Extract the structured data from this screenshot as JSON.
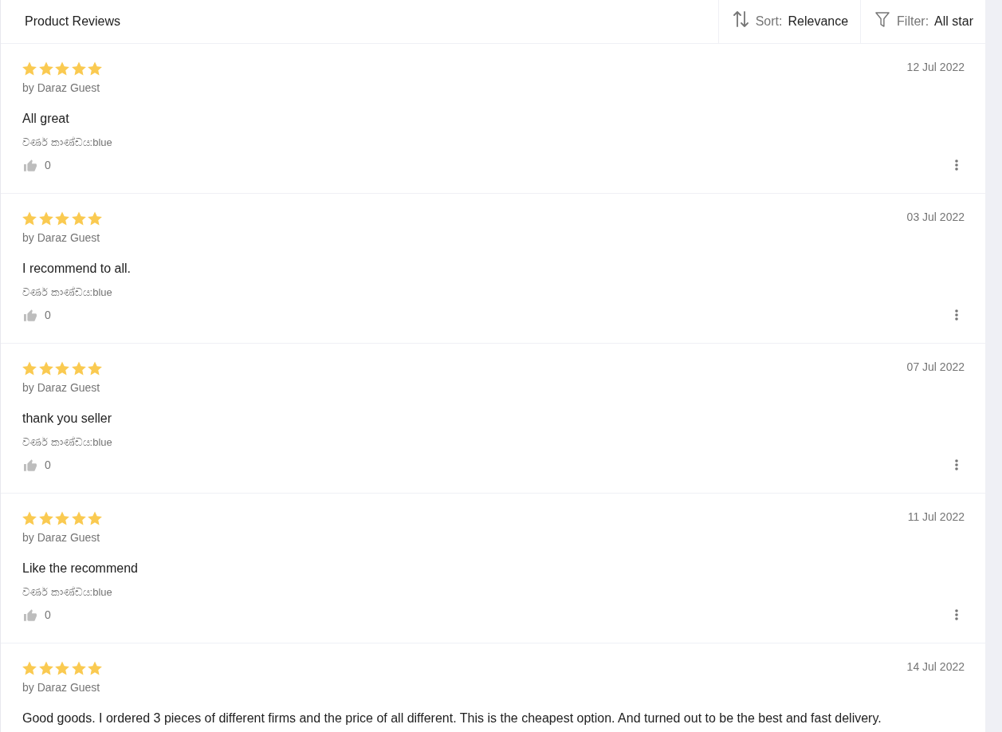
{
  "header": {
    "title": "Product Reviews",
    "sort": {
      "label": "Sort:",
      "value": "Relevance"
    },
    "filter": {
      "label": "Filter:",
      "value": "All star"
    }
  },
  "reviews": [
    {
      "stars": 5,
      "date": "12 Jul 2022",
      "author": "by Daraz Guest",
      "comment": "All great",
      "sku": "වර්ණ කාණ්ඩය:blue",
      "likes": "0"
    },
    {
      "stars": 5,
      "date": "03 Jul 2022",
      "author": "by Daraz Guest",
      "comment": "I recommend to all.",
      "sku": "වර්ණ කාණ්ඩය:blue",
      "likes": "0"
    },
    {
      "stars": 5,
      "date": "07 Jul 2022",
      "author": "by Daraz Guest",
      "comment": "thank you seller",
      "sku": "වර්ණ කාණ්ඩය:blue",
      "likes": "0"
    },
    {
      "stars": 5,
      "date": "11 Jul 2022",
      "author": "by Daraz Guest",
      "comment": "Like the recommend",
      "sku": "වර්ණ කාණ්ඩය:blue",
      "likes": "0"
    },
    {
      "stars": 5,
      "date": "14 Jul 2022",
      "author": "by Daraz Guest",
      "comment": "Good goods. I ordered 3 pieces of different firms and the price of all different. This is the cheapest option. And turned out to be the best and fast delivery."
    }
  ]
}
